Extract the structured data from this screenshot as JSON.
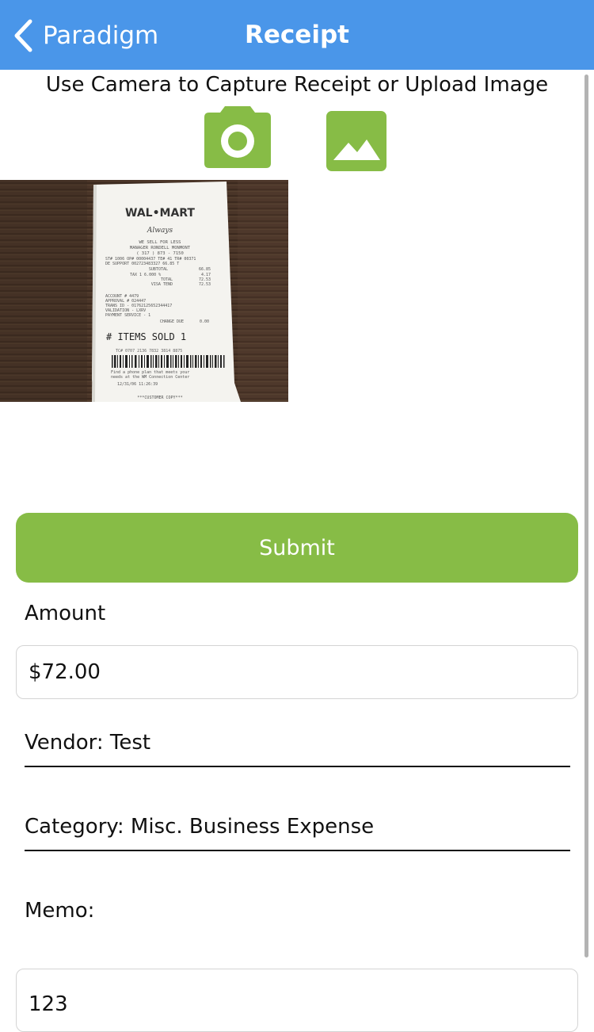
{
  "navbar": {
    "back_label": "Paradigm",
    "title": "Receipt",
    "background_color": "#4a96e9"
  },
  "capture": {
    "instructions": "Use Camera to Capture Receipt or Upload Image",
    "camera_icon": "camera-icon",
    "gallery_icon": "image-icon",
    "accent_color": "#87bc46"
  },
  "receipt_image": {
    "store": "WAL•MART",
    "slogan": "Always",
    "tagline": "WE SELL FOR LESS",
    "manager": "MANAGER RONDELL MONMONT",
    "phone": "( 317 ) 873 - 7150",
    "line_1": "ST# 1006 OP# 00004437 TE# 41 TR# 00371",
    "line_2": "DE SUPPORT   002723483327     66.85 T",
    "subtotal_label": "SUBTOTAL",
    "subtotal_value": "66.85",
    "tax_label": "TAX 1   6.000 %",
    "tax_value": "4.17",
    "total_label": "TOTAL",
    "total_value": "72.53",
    "visa_label": "VISA  TEND",
    "visa_value": "72.53",
    "account_line": "ACCOUNT  # 4479",
    "approval_line": "APPROVAL # 024447",
    "trans_line": "TRANS ID - 01762125652344417",
    "validation_line": "VALIDATION - LXRV",
    "payment_line": "PAYMENT SERVICE - 1",
    "change_label": "CHANGE DUE",
    "change_value": "0.00",
    "items_sold": "# ITEMS SOLD 1",
    "tc_line": "TC# 0707 2136 7832 3814 8875",
    "promo_1": "Find a phone plan that meets your",
    "promo_2": "needs at the WM Connection Center",
    "date_line": "12/31/06       11:26:39",
    "copy_label": "***CUSTOMER COPY***"
  },
  "form": {
    "submit_label": "Submit",
    "amount_label": "Amount",
    "amount_value": "$72.00",
    "vendor_text": "Vendor: Test",
    "category_text": "Category: Misc. Business Expense",
    "memo_label": "Memo:",
    "memo_value": "123"
  }
}
